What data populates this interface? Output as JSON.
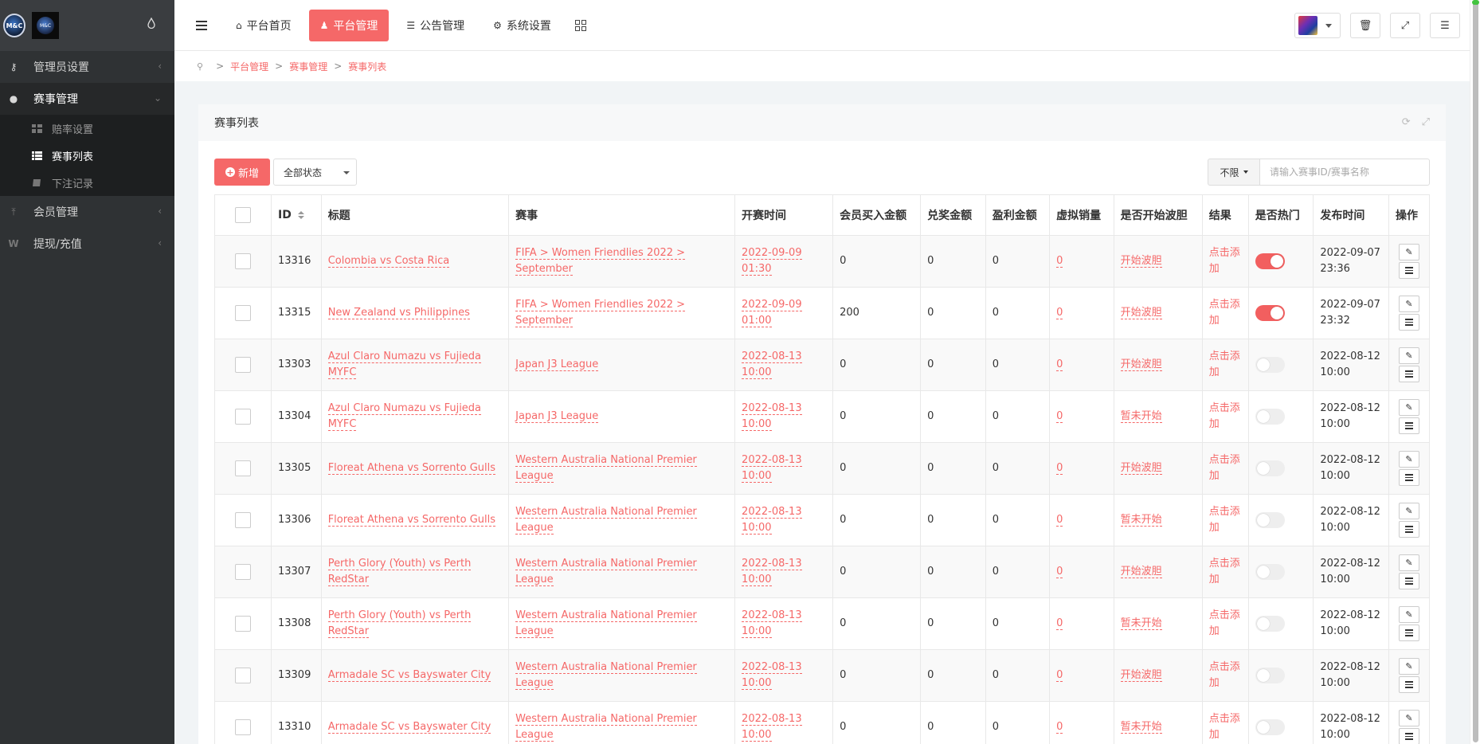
{
  "sidebar": {
    "logo_a_text": "M&C",
    "logo_b_text": "M&C",
    "items": [
      {
        "label": "管理员设置",
        "icon": "key-icon"
      },
      {
        "label": "赛事管理",
        "icon": "users-icon"
      },
      {
        "label": "会员管理",
        "icon": "pin-icon"
      },
      {
        "label": "提现/充值",
        "icon": "w-icon"
      }
    ],
    "sub_items": [
      {
        "label": "赔率设置",
        "icon": "grid-icon"
      },
      {
        "label": "赛事列表",
        "icon": "list-icon"
      },
      {
        "label": "下注记录",
        "icon": "book-icon"
      }
    ]
  },
  "topbar": {
    "tabs": [
      {
        "label": "平台首页",
        "icon": "home-icon"
      },
      {
        "label": "平台管理",
        "icon": "user-icon"
      },
      {
        "label": "公告管理",
        "icon": "list-icon"
      },
      {
        "label": "系统设置",
        "icon": "gear-icon"
      }
    ]
  },
  "breadcrumb": [
    "平台管理",
    "赛事管理",
    "赛事列表"
  ],
  "panel": {
    "title": "赛事列表",
    "add_label": "新增",
    "status_filter": "全部状态",
    "limit_label": "不限",
    "search_placeholder": "请输入赛事ID/赛事名称"
  },
  "table": {
    "headers": [
      "ID",
      "标题",
      "赛事",
      "开赛时间",
      "会员买入金额",
      "兑奖金额",
      "盈利金额",
      "虚拟销量",
      "是否开始波胆",
      "结果",
      "是否热门",
      "发布时间",
      "操作"
    ],
    "rows": [
      {
        "id": "13316",
        "title": "Colombia vs Costa Rica",
        "event": "FIFA > Women Friendlies 2022 > September",
        "start": "2022-09-09 01:30",
        "buy": "0",
        "prize": "0",
        "profit": "0",
        "virtual": "0",
        "bodan": "开始波胆",
        "result": "点击添加",
        "hot": true,
        "published": "2022-09-07 23:36"
      },
      {
        "id": "13315",
        "title": "New Zealand vs Philippines",
        "event": "FIFA > Women Friendlies 2022 > September",
        "start": "2022-09-09 01:00",
        "buy": "200",
        "prize": "0",
        "profit": "0",
        "virtual": "0",
        "bodan": "开始波胆",
        "result": "点击添加",
        "hot": true,
        "published": "2022-09-07 23:32"
      },
      {
        "id": "13303",
        "title": "Azul Claro Numazu vs Fujieda MYFC",
        "event": "Japan J3 League",
        "start": "2022-08-13 10:00",
        "buy": "0",
        "prize": "0",
        "profit": "0",
        "virtual": "0",
        "bodan": "开始波胆",
        "result": "点击添加",
        "hot": false,
        "published": "2022-08-12 10:00"
      },
      {
        "id": "13304",
        "title": "Azul Claro Numazu vs Fujieda MYFC",
        "event": "Japan J3 League",
        "start": "2022-08-13 10:00",
        "buy": "0",
        "prize": "0",
        "profit": "0",
        "virtual": "0",
        "bodan": "暂未开始",
        "result": "点击添加",
        "hot": false,
        "published": "2022-08-12 10:00"
      },
      {
        "id": "13305",
        "title": "Floreat Athena vs Sorrento Gulls",
        "event": "Western Australia National Premier League",
        "start": "2022-08-13 10:00",
        "buy": "0",
        "prize": "0",
        "profit": "0",
        "virtual": "0",
        "bodan": "开始波胆",
        "result": "点击添加",
        "hot": false,
        "published": "2022-08-12 10:00"
      },
      {
        "id": "13306",
        "title": "Floreat Athena vs Sorrento Gulls",
        "event": "Western Australia National Premier League",
        "start": "2022-08-13 10:00",
        "buy": "0",
        "prize": "0",
        "profit": "0",
        "virtual": "0",
        "bodan": "暂未开始",
        "result": "点击添加",
        "hot": false,
        "published": "2022-08-12 10:00"
      },
      {
        "id": "13307",
        "title": "Perth Glory (Youth) vs Perth RedStar",
        "event": "Western Australia National Premier League",
        "start": "2022-08-13 10:00",
        "buy": "0",
        "prize": "0",
        "profit": "0",
        "virtual": "0",
        "bodan": "开始波胆",
        "result": "点击添加",
        "hot": false,
        "published": "2022-08-12 10:00"
      },
      {
        "id": "13308",
        "title": "Perth Glory (Youth) vs Perth RedStar",
        "event": "Western Australia National Premier League",
        "start": "2022-08-13 10:00",
        "buy": "0",
        "prize": "0",
        "profit": "0",
        "virtual": "0",
        "bodan": "暂未开始",
        "result": "点击添加",
        "hot": false,
        "published": "2022-08-12 10:00"
      },
      {
        "id": "13309",
        "title": "Armadale SC vs Bayswater City",
        "event": "Western Australia National Premier League",
        "start": "2022-08-13 10:00",
        "buy": "0",
        "prize": "0",
        "profit": "0",
        "virtual": "0",
        "bodan": "开始波胆",
        "result": "点击添加",
        "hot": false,
        "published": "2022-08-12 10:00"
      },
      {
        "id": "13310",
        "title": "Armadale SC vs Bayswater City",
        "event": "Western Australia National Premier League",
        "start": "2022-08-13 10:00",
        "buy": "0",
        "prize": "0",
        "profit": "0",
        "virtual": "0",
        "bodan": "暂未开始",
        "result": "点击添加",
        "hot": false,
        "published": "2022-08-12 10:00"
      }
    ]
  },
  "colors": {
    "accent": "#f56868",
    "sidebar_bg": "#2f3234",
    "switch_on": "#f25f5f"
  }
}
